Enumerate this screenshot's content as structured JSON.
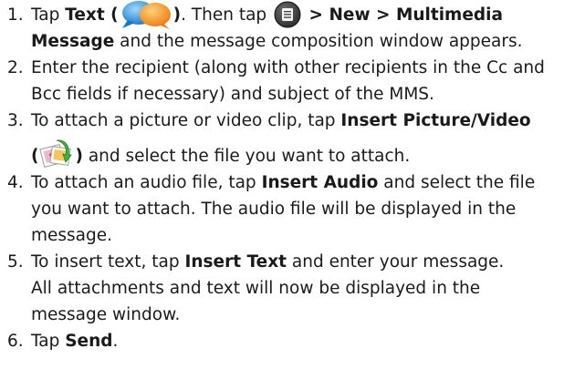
{
  "steps": [
    {
      "num": "1.",
      "a": "Tap ",
      "b1": "Text (",
      "b2": ")",
      "c": ". Then tap ",
      "b3": " > New > Multimedia Message",
      "d": " and the message composition window appears."
    },
    {
      "num": "2.",
      "a": "Enter the recipient (along with other recipients in the Cc and Bcc fields if necessary) and subject of the MMS."
    },
    {
      "num": "3.",
      "a": "To attach a picture or video clip, tap ",
      "b1": "Insert Picture/Video",
      "b2": "(",
      "b3": ")",
      "c": " and select the file you want to attach."
    },
    {
      "num": "4.",
      "a": "To attach an audio file, tap ",
      "b1": "Insert Audio",
      "c": " and select the file you want to attach. The audio file will be displayed in the message."
    },
    {
      "num": "5.",
      "a": "To insert text, tap ",
      "b1": "Insert Text",
      "c": " and enter your message.",
      "d": "All attachments and text will now be displayed in the message window."
    },
    {
      "num": "6.",
      "a": "Tap ",
      "b1": "Send",
      "c": "."
    }
  ],
  "icons": {
    "text_icon": "speech-bubbles-icon",
    "menu_icon": "menu-icon",
    "insert_picture_icon": "insert-picture-icon"
  }
}
